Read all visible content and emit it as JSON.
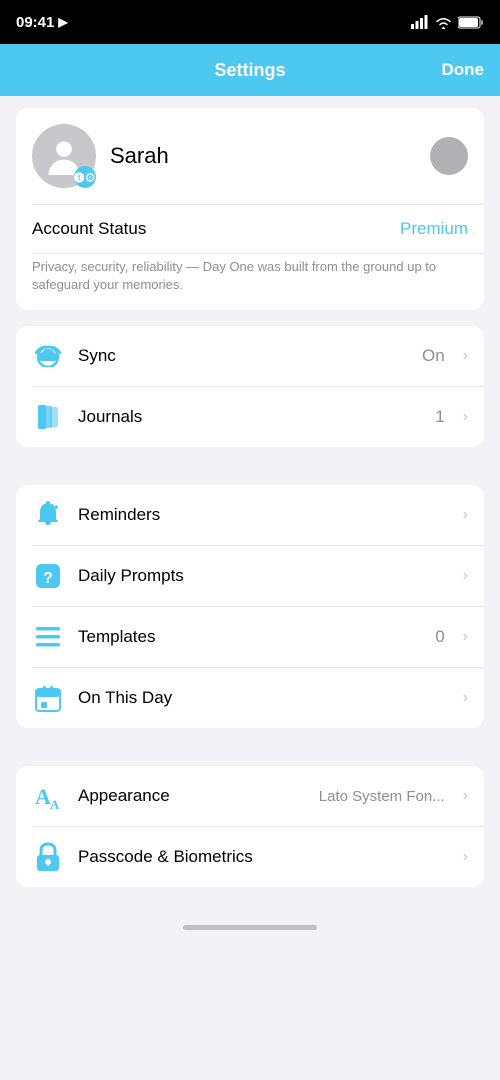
{
  "statusBar": {
    "time": "09:41",
    "navigationArrow": "▲"
  },
  "navBar": {
    "title": "Settings",
    "doneLabel": "Done"
  },
  "profile": {
    "name": "Sarah"
  },
  "accountSection": {
    "statusLabel": "Account Status",
    "statusValue": "Premium",
    "privacyText": "Privacy, security, reliability — Day One was built from the ground up to safeguard your memories."
  },
  "syncSection": {
    "syncLabel": "Sync",
    "syncValue": "On",
    "journalsLabel": "Journals",
    "journalsValue": "1"
  },
  "featuresSection": {
    "remindersLabel": "Reminders",
    "dailyPromptsLabel": "Daily Prompts",
    "templatesLabel": "Templates",
    "templatesValue": "0",
    "onThisDayLabel": "On This Day"
  },
  "settingsSection": {
    "appearanceLabel": "Appearance",
    "appearanceValue": "Lato System Fon...",
    "passcodeLabel": "Passcode & Biometrics"
  }
}
